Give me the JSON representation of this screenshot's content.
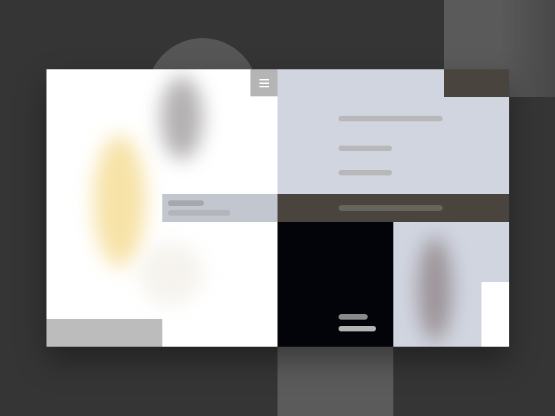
{
  "screen": {
    "theme": "abstract-ui-mockup",
    "background_color": "#353535"
  },
  "menu": {
    "icon": "hamburger-icon"
  },
  "palette": {
    "card_left": "#ffffff",
    "card_right": "#d0d5e0",
    "accent_dark": "#4a443e",
    "dark_block": "#03030a",
    "muted_gray": "#bcbcbc",
    "soft_blue_gray": "#c2c6ce"
  }
}
